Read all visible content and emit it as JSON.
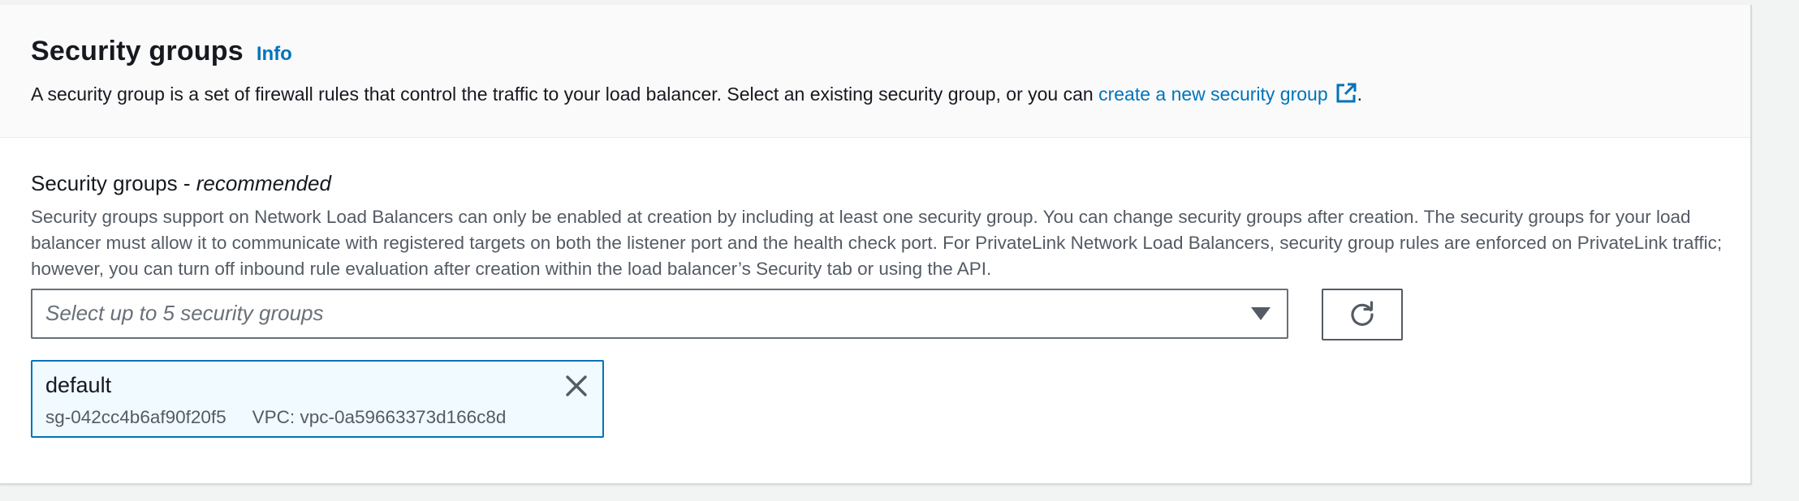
{
  "header": {
    "title": "Security groups",
    "info_link": "Info",
    "description_prefix": "A security group is a set of firewall rules that control the traffic to your load balancer. Select an existing security group, or you can ",
    "create_link": "create a new security group",
    "description_suffix": "."
  },
  "field": {
    "label_main": "Security groups - ",
    "label_emphasis": "recommended",
    "description": "Security groups support on Network Load Balancers can only be enabled at creation by including at least one security group. You can change security groups after creation. The security groups for your load balancer must allow it to communicate with registered targets on both the listener port and the health check port. For PrivateLink Network Load Balancers, security group rules are enforced on PrivateLink traffic; however, you can turn off inbound rule evaluation after creation within the load balancer’s Security tab or using the API."
  },
  "select": {
    "placeholder": "Select up to 5 security groups"
  },
  "selected_groups": [
    {
      "name": "default",
      "id": "sg-042cc4b6af90f20f5",
      "vpc": "VPC: vpc-0a59663373d166c8d"
    }
  ],
  "icons": {
    "external_link": "external-link-icon",
    "dropdown": "caret-down-icon",
    "refresh": "refresh-icon",
    "remove": "close-icon"
  },
  "colors": {
    "link": "#0073bb",
    "token_bg": "#f1faff",
    "token_border": "#0073bb",
    "text": "#16191f",
    "secondary_text": "#545b64"
  }
}
